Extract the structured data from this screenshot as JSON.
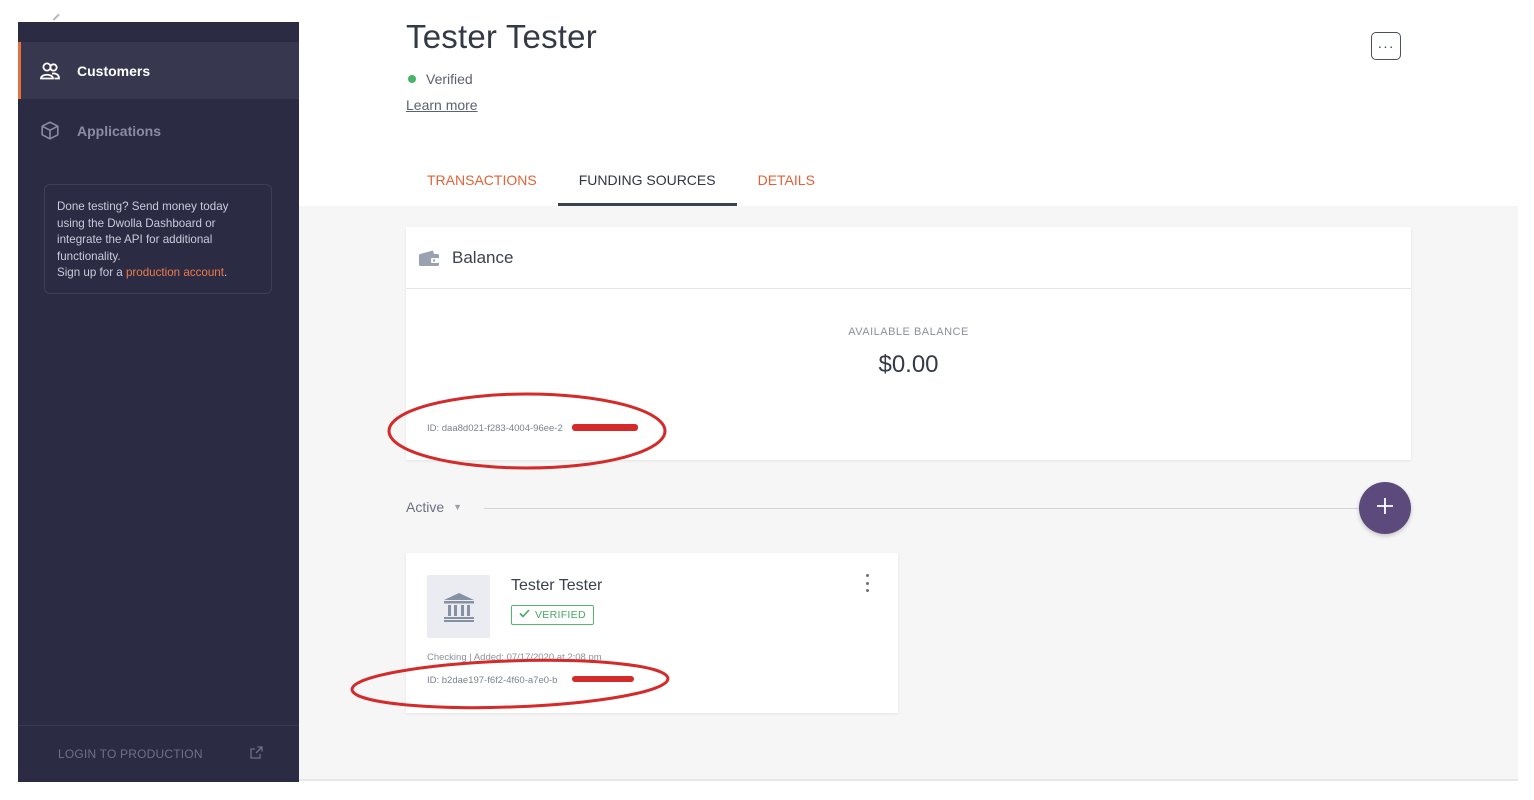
{
  "sidebar": {
    "items": [
      {
        "label": "Customers",
        "icon": "users-icon",
        "active": true
      },
      {
        "label": "Applications",
        "icon": "cube-icon",
        "active": false
      }
    ],
    "promo": {
      "text": "Done testing? Send money today using the Dwolla Dashboard or integrate the API for additional functionality.",
      "signup_prefix": "Sign up for a ",
      "signup_link": "production account",
      "signup_suffix": "."
    },
    "footer": {
      "label": "LOGIN TO PRODUCTION",
      "icon": "external-link-icon"
    }
  },
  "header": {
    "customer_name": "Tester Tester",
    "status": "Verified",
    "status_color": "#46b567",
    "learn_more": "Learn more",
    "more_label": "···"
  },
  "tabs": [
    {
      "label": "TRANSACTIONS",
      "active": false
    },
    {
      "label": "FUNDING SOURCES",
      "active": true
    },
    {
      "label": "DETAILS",
      "active": false
    }
  ],
  "balance": {
    "title": "Balance",
    "available_label": "AVAILABLE BALANCE",
    "amount": "$0.00",
    "id": "ID: daa8d021-f283-4004-96ee-2"
  },
  "filter": {
    "label": "Active",
    "add_label": "+"
  },
  "funding_source": {
    "name": "Tester Tester",
    "badge": "VERIFIED",
    "meta": "Checking | Added: 07/17/2020 at 2:08 pm",
    "id": "ID: b2dae197-f6f2-4f60-a7e0-b"
  },
  "colors": {
    "sidebar_bg": "#2b2c44",
    "accent_orange": "#e8703a",
    "add_button": "#5c4a7c",
    "verified_green": "#46a861",
    "annotation_red": "#d42a2a"
  }
}
